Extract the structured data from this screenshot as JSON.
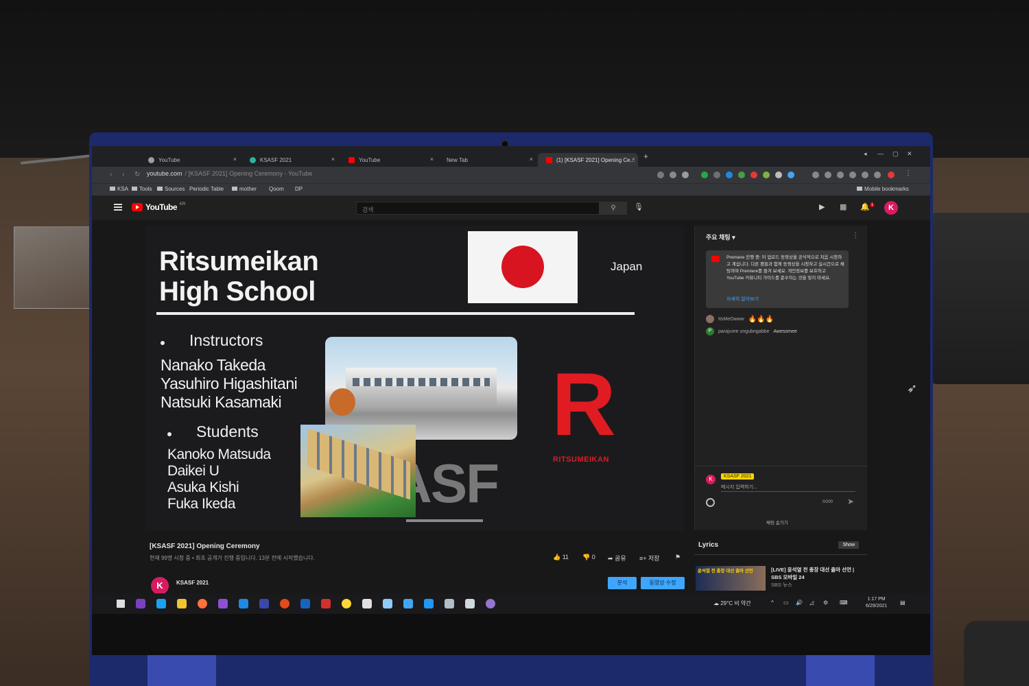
{
  "browser": {
    "tabs": [
      {
        "label": "YouTube"
      },
      {
        "label": "KSASF 2021"
      },
      {
        "label": "YouTube"
      },
      {
        "label": "New Tab"
      },
      {
        "label": "(1) [KSASF 2021] Opening Ce..."
      }
    ],
    "url": "youtube.com",
    "url_path": "/ [KSASF 2021] Opening Ceremony - YouTube",
    "bookmarks": [
      "KSA",
      "Tools",
      "Sources",
      "Periodic Table",
      "mother",
      "Qoom",
      "DP"
    ],
    "mobile_bookmarks": "Mobile bookmarks"
  },
  "youtube": {
    "logo_text": "YouTube",
    "logo_region": "KR",
    "search_placeholder": "검색",
    "notification_count": "1",
    "account_initial": "K"
  },
  "slide": {
    "school_line1": "Ritsumeikan",
    "school_line2": "High School",
    "country": "Japan",
    "instructors_heading": "Instructors",
    "instructors": [
      "Nanako Takeda",
      "Yasuhiro Higashitani",
      "Natsuki Kasamaki"
    ],
    "students_heading": "Students",
    "students": [
      "Kanoko Matsuda",
      "Daikei U",
      "Asuka Kishi",
      "Fuka Ikeda"
    ],
    "watermark": "ASF",
    "logo_letter": "R",
    "logo_text": "RITSUMEIKAN",
    "flag_colors": {
      "field": "#f4f4f4",
      "disc": "#d81420"
    }
  },
  "video": {
    "title": "[KSASF 2021] Opening Ceremony",
    "meta": "현재 99명 시청 중 • 최초 공개가 진행 중입니다. 13분 전에 시작했습니다.",
    "likes": "11",
    "dislikes": "0",
    "share_label": "공유",
    "save_label": "저장",
    "channel_name": "KSASF 2021",
    "channel_initial": "K",
    "analytics_label": "분석",
    "edit_label": "동영상 수정"
  },
  "chat": {
    "header": "주요 채팅",
    "notice": "Premiere 진행 중: 이 업로드 동영상을 공식적으로 처음 시청하고 계십니다. 다른 팬들과 함께 동영상을 시청하고 실시간으로 채팅하며 Premiere를 즐겨 보세요. 개인정보를 보호하고 YouTube 커뮤니티 가이드를 준수하는 것을 잊지 마세요.",
    "notice_link": "자세히 알아보기",
    "messages": [
      {
        "author": "ItsMeOwww",
        "text": "🔥🔥🔥",
        "initial": ""
      },
      {
        "author": "parajuree ungubngabbe",
        "text": "Awesomee",
        "initial": "P"
      }
    ],
    "badge": "KSASF 2021",
    "input_placeholder": "메시지 입력하기...",
    "char_count": "0/200",
    "hide_label": "채팅 숨기기"
  },
  "sidebar": {
    "lyrics_label": "Lyrics",
    "show_label": "Show",
    "rec_thumb_text": "윤석열 전 총장 대선 출마 선언",
    "rec_title": "[LIVE] 윤석열 전 총장 대선 출마 선언 | SBS 모바일 24",
    "rec_channel": "SBS 뉴스"
  },
  "taskbar": {
    "weather": "29°C 비 약간",
    "time": "1:17 PM",
    "date": "6/29/2021"
  }
}
